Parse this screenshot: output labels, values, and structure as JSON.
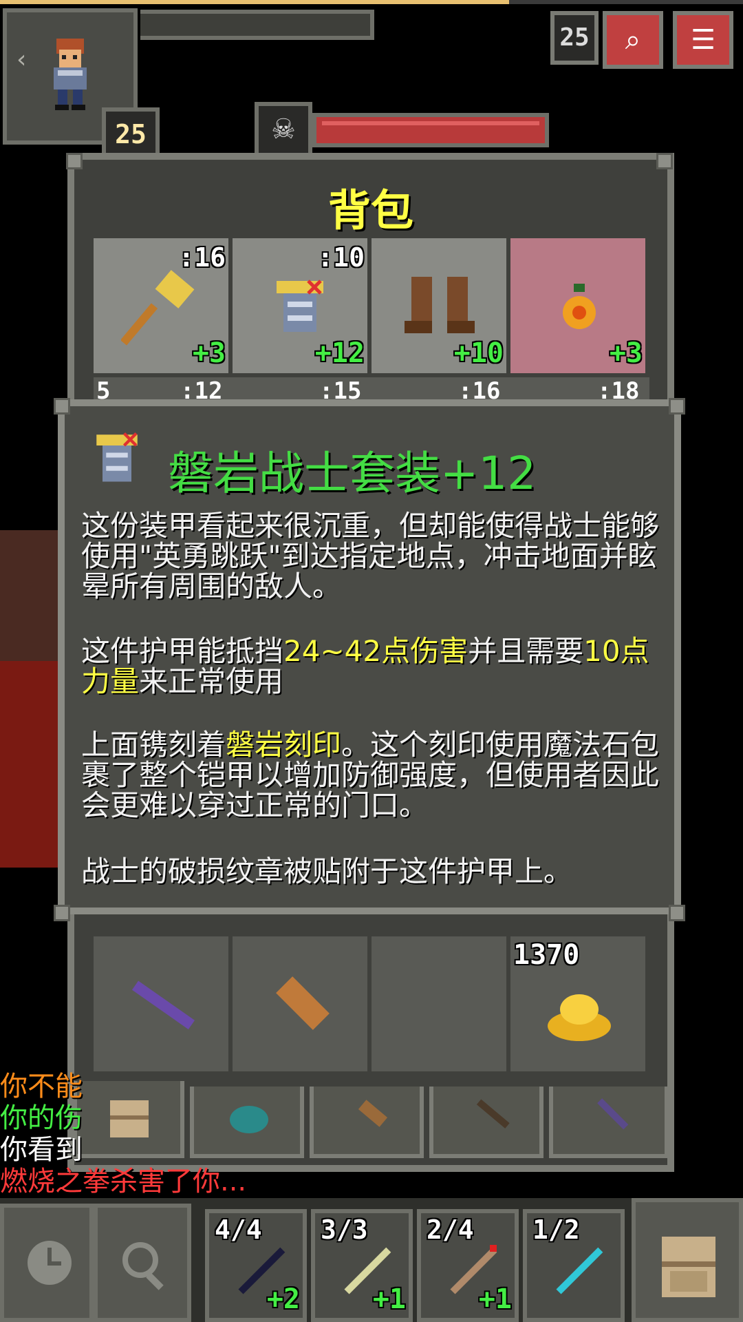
{
  "hud": {
    "hero_level": "25",
    "dungeon_depth": "25",
    "journal_icon": "journal-icon",
    "menu_icon": "menu-icon",
    "boss_icon": "skull-icon"
  },
  "backpack": {
    "title": "背包",
    "row1": [
      {
        "icon": "golden-hammer-icon",
        "qty": ":16",
        "upgrade": "+3"
      },
      {
        "icon": "armor-icon",
        "qty": ":10",
        "upgrade": "+12"
      },
      {
        "icon": "boots-icon",
        "qty": "",
        "upgrade": "+10"
      },
      {
        "icon": "amulet-icon",
        "qty": "",
        "upgrade": "+3"
      }
    ],
    "row2_partial": [
      "5",
      ":12",
      ":15",
      ":16",
      ":18"
    ],
    "row_bottom": [
      {
        "icon": "purple-wand-icon",
        "qty": ""
      },
      {
        "icon": "scroll-icon",
        "qty": ""
      },
      {
        "icon": "empty-slot",
        "qty": ""
      },
      {
        "icon": "gold-pile-icon",
        "qty": "1370"
      }
    ],
    "tabs": [
      "backpack-tab-icon",
      "pouch-tab-icon",
      "scroll-holder-tab-icon",
      "wand-holster-tab-icon",
      "magic-holster-tab-icon"
    ]
  },
  "info": {
    "title": "磐岩战士套装+12",
    "p1": "这份装甲看起来很沉重，但却能使得战士能够使用\"英勇跳跃\"到达指定地点，冲击地面并眩晕所有周围的敌人。",
    "p2_a": "这件护甲能抵挡",
    "p2_b": "24~42点伤害",
    "p2_c": "并且需要",
    "p2_d": "10点力量",
    "p2_e": "来正常使用",
    "p3_a": "上面镌刻着",
    "p3_b": "磐岩刻印",
    "p3_c": "。这个刻印使用魔法石包裹了整个铠甲以增加防御强度，但使用者因此会更难以穿过正常的门口。",
    "p4": "战士的破损纹章被贴附于这件护甲上。"
  },
  "log": [
    {
      "text": "你不能",
      "color": "#ff8c1a"
    },
    {
      "text": "你的伤",
      "color": "#44ee44"
    },
    {
      "text": "你看到",
      "color": "#ffffff"
    },
    {
      "text": "燃烧之拳杀害了你...",
      "color": "#ff3a3a"
    }
  ],
  "toolbar": {
    "wait_icon": "clock-icon",
    "search_icon": "magnifier-icon",
    "quickslots": [
      {
        "count": "4/4",
        "upgrade": "+2",
        "icon": "dark-wand-icon"
      },
      {
        "count": "3/3",
        "upgrade": "+1",
        "icon": "lightning-wand-icon"
      },
      {
        "count": "2/4",
        "upgrade": "+1",
        "icon": "fire-wand-icon"
      },
      {
        "count": "1/2",
        "upgrade": "",
        "icon": "frost-wand-icon"
      }
    ],
    "bag_icon": "backpack-icon"
  },
  "colors": {
    "highlight": "#ffff44",
    "title_green": "#44dd44",
    "upgrade_green": "#44ee44"
  }
}
